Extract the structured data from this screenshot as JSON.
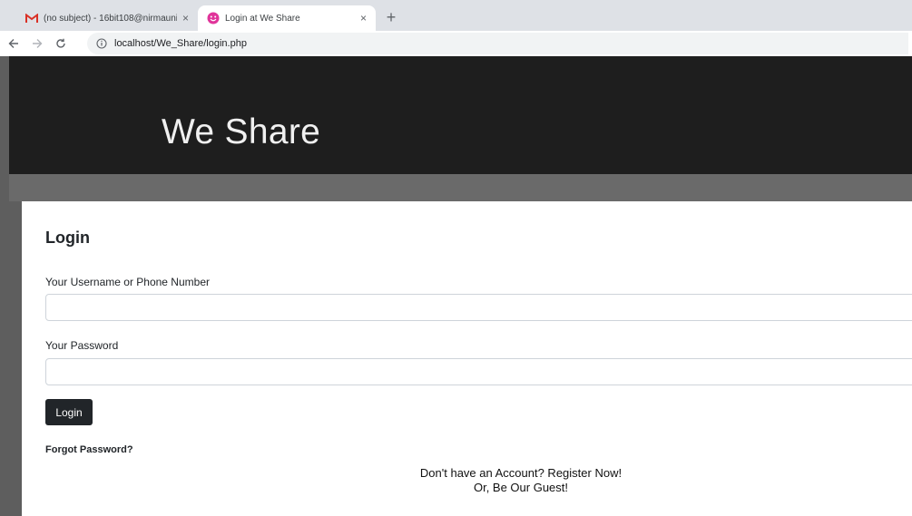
{
  "browser": {
    "tabs": [
      {
        "title": "(no subject) - 16bit108@nirmauni",
        "icon": "gmail-icon",
        "active": false
      },
      {
        "title": "Login at We Share",
        "icon": "smiley-favicon-icon",
        "active": true
      }
    ],
    "new_tab_symbol": "+",
    "tab_close_symbol": "×",
    "url": "localhost/We_Share/login.php",
    "colors": {
      "gmail_red": "#d93025",
      "favicon_pink": "#e0349a"
    }
  },
  "header": {
    "site_title": "We Share",
    "background": "#1e1e1e"
  },
  "login": {
    "heading": "Login",
    "username_label": "Your Username or Phone Number",
    "username_value": "",
    "password_label": "Your Password",
    "password_value": "",
    "submit_label": "Login",
    "forgot_label": "Forgot Password?",
    "register_text": "Don't have an Account? Register Now!",
    "guest_text": "Or, Be Our Guest!"
  }
}
